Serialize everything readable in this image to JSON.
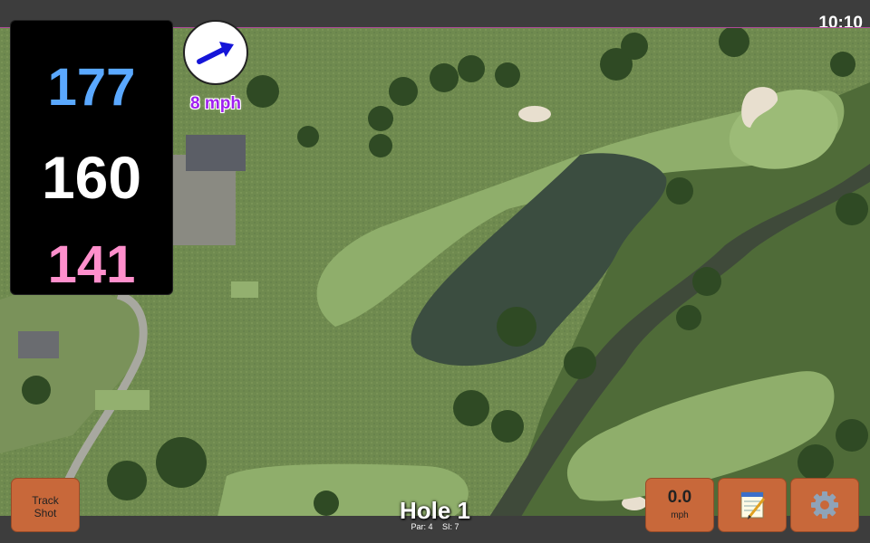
{
  "clock": "10:10",
  "yardages": {
    "back": "177",
    "middle": "160",
    "front": "141"
  },
  "wind": {
    "speed_label": "8 mph",
    "icon": "wind-direction-arrow-icon"
  },
  "buttons": {
    "track_shot_line1": "Track",
    "track_shot_line2": "Shot",
    "speed_value": "0.0",
    "speed_unit": "mph",
    "notes_icon": "notepad-icon",
    "settings_icon": "gear-icon"
  },
  "hole": {
    "title": "Hole 1",
    "par": "Par: 4",
    "si": "SI: 7"
  },
  "colors": {
    "back": "#5aa8ff",
    "middle": "#ffffff",
    "front": "#ff8fcc",
    "button": "#c8683a",
    "wind_text": "#a020f0"
  }
}
